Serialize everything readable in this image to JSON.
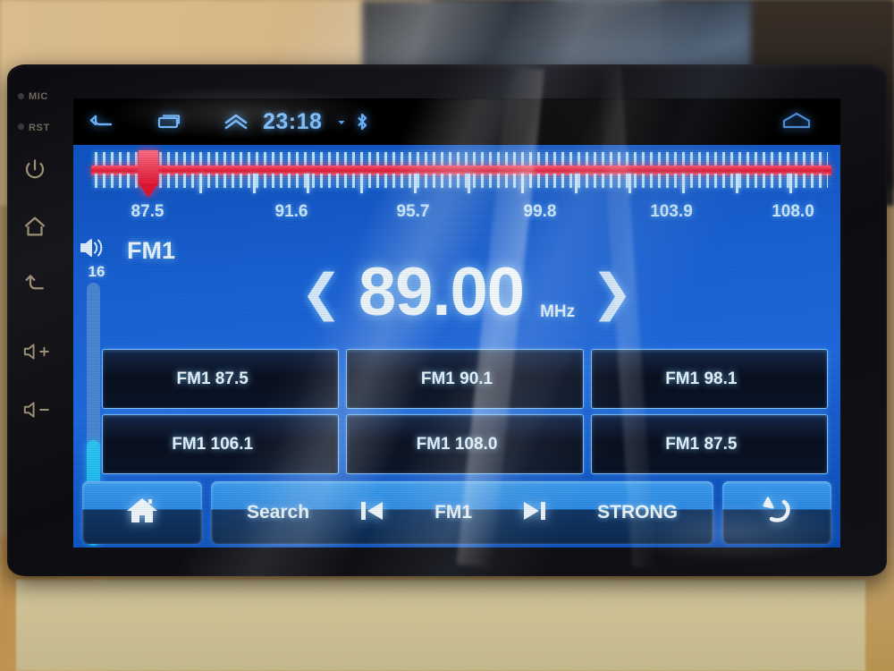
{
  "device": {
    "bezel_keys": [
      {
        "name": "mic",
        "label": "MIC"
      },
      {
        "name": "reset",
        "label": "RST"
      },
      {
        "name": "power",
        "label": ""
      },
      {
        "name": "home",
        "label": ""
      },
      {
        "name": "back",
        "label": ""
      },
      {
        "name": "volume-up",
        "label": ""
      },
      {
        "name": "volume-down",
        "label": ""
      }
    ]
  },
  "statusbar": {
    "back_icon": "back-arrow-icon",
    "recents_icon": "recent-apps-icon",
    "expand_icon": "chevron-up-icon",
    "time": "23:18",
    "download_icon": "download-arrow-icon",
    "bluetooth_icon": "bluetooth-icon",
    "home_icon": "home-outline-icon"
  },
  "tuner": {
    "scale_labels": [
      "87.5",
      "91.6",
      "95.7",
      "99.8",
      "103.9",
      "108.0"
    ],
    "marker_frequency": "89.00",
    "range_min": 87.5,
    "range_max": 108.0,
    "line_color": "#e3152f",
    "tick_color": "#bfe4ff"
  },
  "volume": {
    "icon": "speaker-volume-icon",
    "level": "16",
    "max": 40
  },
  "band": {
    "label": "FM1"
  },
  "frequency": {
    "prev_icon": "chevron-left-icon",
    "value": "89.00",
    "unit": "MHz",
    "next_icon": "chevron-right-icon"
  },
  "presets": [
    {
      "label": "FM1 87.5"
    },
    {
      "label": "FM1 90.1"
    },
    {
      "label": "FM1 98.1"
    },
    {
      "label": "FM1 106.1"
    },
    {
      "label": "FM1 108.0"
    },
    {
      "label": "FM1 87.5"
    }
  ],
  "bottombar": {
    "home_icon": "home-filled-icon",
    "search_label": "Search",
    "prev_icon": "skip-previous-icon",
    "band_label": "FM1",
    "next_icon": "skip-next-icon",
    "signal_label": "STRONG",
    "back_icon": "return-arrow-icon"
  },
  "colors": {
    "screen_blue": "#1a63d8",
    "accent_cyan": "#35e8ff",
    "tuner_red": "#e3152f",
    "text_light": "#eaf6ff"
  }
}
